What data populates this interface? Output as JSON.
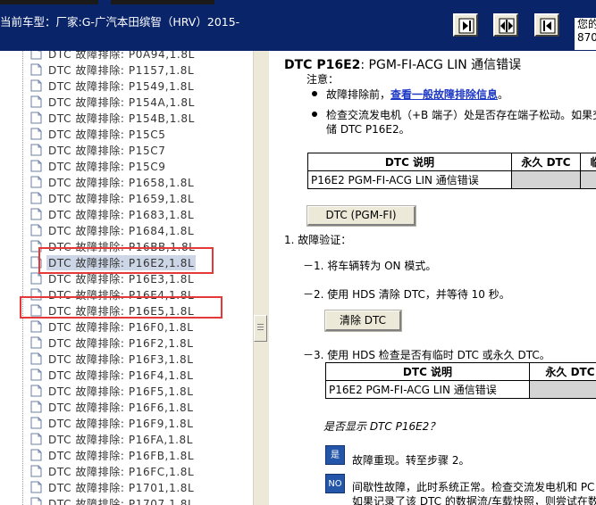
{
  "header": {
    "vehicle_label": "当前车型：厂家:G-广汽本田缤智（HRV）2015-",
    "topright_line1": "您的",
    "topright_line2": "870",
    "buttons": [
      {
        "name": "collapse-left-button",
        "icon": "arrow-right-to-bar-icon"
      },
      {
        "name": "split-view-button",
        "icon": "split-arrows-icon"
      },
      {
        "name": "collapse-right-button",
        "icon": "arrow-left-from-bar-icon"
      }
    ]
  },
  "tree": {
    "items": [
      {
        "label": "DTC 故障排除: P0A94,1.8L"
      },
      {
        "label": "DTC 故障排除: P1157,1.8L"
      },
      {
        "label": "DTC 故障排除: P1549,1.8L"
      },
      {
        "label": "DTC 故障排除: P154A,1.8L"
      },
      {
        "label": "DTC 故障排除: P154B,1.8L"
      },
      {
        "label": "DTC 故障排除: P15C5"
      },
      {
        "label": "DTC 故障排除: P15C7"
      },
      {
        "label": "DTC 故障排除: P15C9"
      },
      {
        "label": "DTC 故障排除: P1658,1.8L"
      },
      {
        "label": "DTC 故障排除: P1659,1.8L"
      },
      {
        "label": "DTC 故障排除: P1683,1.8L"
      },
      {
        "label": "DTC 故障排除: P1684,1.8L"
      },
      {
        "label": "DTC 故障排除: P16BB,1.8L"
      },
      {
        "label": "DTC 故障排除: P16E2,1.8L",
        "selected": true
      },
      {
        "label": "DTC 故障排除: P16E3,1.8L"
      },
      {
        "label": "DTC 故障排除: P16E4,1.8L"
      },
      {
        "label": "DTC 故障排除: P16E5,1.8L"
      },
      {
        "label": "DTC 故障排除: P16F0,1.8L"
      },
      {
        "label": "DTC 故障排除: P16F2,1.8L"
      },
      {
        "label": "DTC 故障排除: P16F3,1.8L"
      },
      {
        "label": "DTC 故障排除: P16F4,1.8L"
      },
      {
        "label": "DTC 故障排除: P16F5,1.8L"
      },
      {
        "label": "DTC 故障排除: P16F6,1.8L"
      },
      {
        "label": "DTC 故障排除: P16F9,1.8L"
      },
      {
        "label": "DTC 故障排除: P16FA,1.8L"
      },
      {
        "label": "DTC 故障排除: P16FB,1.8L"
      },
      {
        "label": "DTC 故障排除: P16FC,1.8L"
      },
      {
        "label": "DTC 故障排除: P1701,1.8L"
      },
      {
        "label": "DTC 故障排除: P1707,1.8L"
      }
    ],
    "highlight_color": "#e53838"
  },
  "content": {
    "title_code": "DTC P16E2",
    "title_desc": ": PGM-FI-ACG LIN 通信错误",
    "note_label": "注意：",
    "note1_prefix": "故障排除前，",
    "note1_link": "查看一般故障排除信息",
    "note1_suffix": "。",
    "note2_line1": "检查交流发电机（+B 端子）处是否存在端子松动。如果交",
    "note2_line2": "储  DTC P16E2。",
    "table1": {
      "headers": [
        "DTC 说明",
        "永久  DTC",
        "临"
      ],
      "row": [
        "P16E2 PGM-FI-ACG LIN 通信错误",
        "",
        ""
      ]
    },
    "dtc_button": "DTC (PGM-FI)",
    "step1": "1.  故障验证：",
    "step1_1": "－1. 将车辆转为  ON 模式。",
    "step1_2": "－2. 使用  HDS 清除  DTC，并等待  10 秒。",
    "clear_button": "清除  DTC",
    "step1_3": "－3. 使用  HDS 检查是否有临时  DTC 或永久  DTC。",
    "table2": {
      "headers": [
        "DTC 说明",
        "永久  DTC"
      ],
      "row": [
        "P16E2 PGM-FI-ACG LIN 通信错误",
        ""
      ]
    },
    "question": "是否显示  DTC P16E2？",
    "yes_icon": "是",
    "yes_text": "故障重现。转至步骤  2。",
    "no_icon": "NO",
    "no_line1": "间歇性故障，此时系统正常。检查交流发电机和  PC",
    "no_line2": "如果记录了该  DTC 的数据流/车载快照，则尝试在数"
  },
  "colors": {
    "header_bg": "#0a246a",
    "link": "#1b37c4",
    "answer_icon_bg": "#2356a8",
    "table_gray": "#d4d4d4"
  }
}
